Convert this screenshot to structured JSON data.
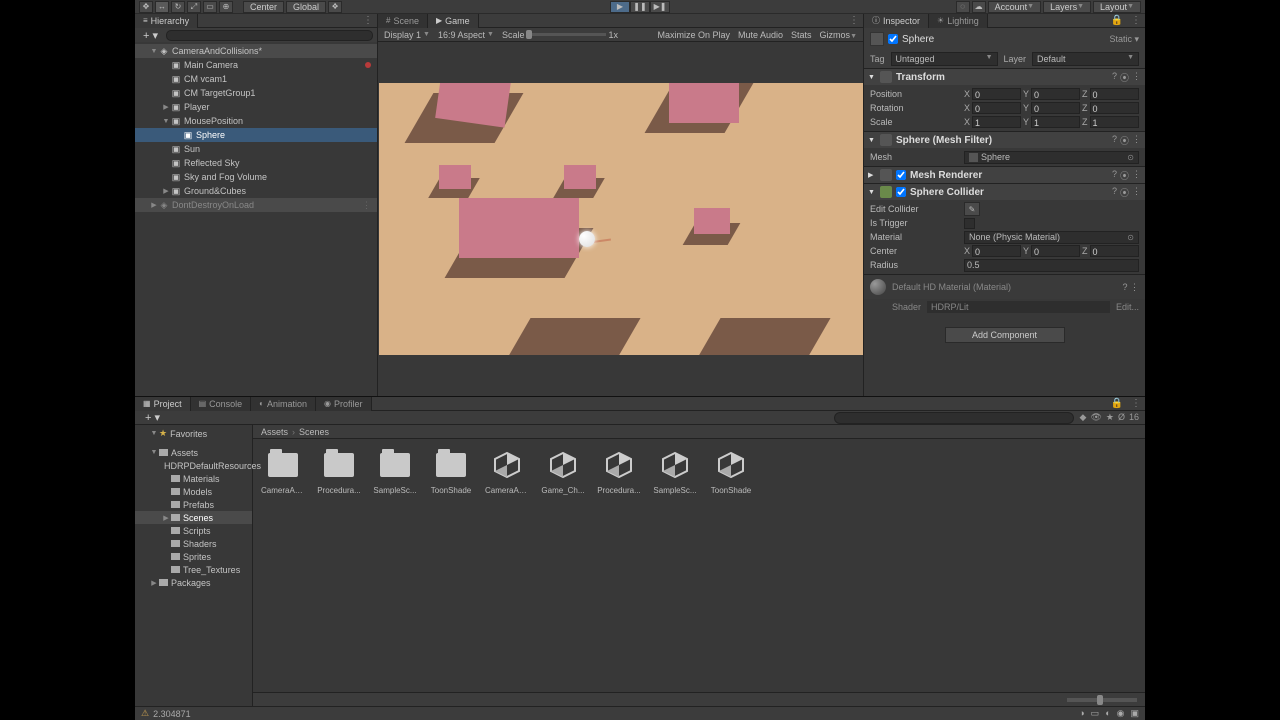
{
  "toolbar": {
    "handles": [
      "✥",
      "↔",
      "↻",
      "⤢",
      "▭",
      "⊕"
    ],
    "pivot": "Center",
    "space": "Global",
    "play_active": true,
    "account": "Account",
    "layers": "Layers",
    "layout": "Layout"
  },
  "hierarchy": {
    "tab": "Hierarchy",
    "scene": "CameraAndCollisions*",
    "items": [
      {
        "name": "Main Camera",
        "indent": 2,
        "rec": true
      },
      {
        "name": "CM vcam1",
        "indent": 2
      },
      {
        "name": "CM TargetGroup1",
        "indent": 2
      },
      {
        "name": "Player",
        "indent": 2,
        "fold": "▶"
      },
      {
        "name": "MousePosition",
        "indent": 2,
        "fold": "▼"
      },
      {
        "name": "Sphere",
        "indent": 3,
        "selected": true
      },
      {
        "name": "Sun",
        "indent": 2
      },
      {
        "name": "Reflected Sky",
        "indent": 2
      },
      {
        "name": "Sky and Fog Volume",
        "indent": 2
      },
      {
        "name": "Ground&Cubes",
        "indent": 2,
        "fold": "▶"
      },
      {
        "name": "DontDestroyOnLoad",
        "indent": 1,
        "grey": true,
        "scene": true
      }
    ]
  },
  "scene_tabs": {
    "scene": "Scene",
    "game": "Game",
    "active": "Game"
  },
  "game_bar": {
    "display": "Display 1",
    "aspect": "16:9 Aspect",
    "scale_lbl": "Scale",
    "scale_val": "1x",
    "maximize": "Maximize On Play",
    "mute": "Mute Audio",
    "stats": "Stats",
    "gizmos": "Gizmos"
  },
  "inspector": {
    "tabs": {
      "inspector": "Inspector",
      "lighting": "Lighting"
    },
    "obj_name": "Sphere",
    "static": "Static",
    "tag_lbl": "Tag",
    "tag_val": "Untagged",
    "layer_lbl": "Layer",
    "layer_val": "Default",
    "transform": {
      "title": "Transform",
      "pos_lbl": "Position",
      "px": "0",
      "py": "0",
      "pz": "0",
      "rot_lbl": "Rotation",
      "rx": "0",
      "ry": "0",
      "rz": "0",
      "scl_lbl": "Scale",
      "sx": "1",
      "sy": "1",
      "sz": "1"
    },
    "meshfilter": {
      "title": "Sphere (Mesh Filter)",
      "mesh_lbl": "Mesh",
      "mesh_val": "Sphere"
    },
    "meshrenderer": {
      "title": "Mesh Renderer"
    },
    "collider": {
      "title": "Sphere Collider",
      "edit_lbl": "Edit Collider",
      "trigger_lbl": "Is Trigger",
      "material_lbl": "Material",
      "material_val": "None (Physic Material)",
      "center_lbl": "Center",
      "cx": "0",
      "cy": "0",
      "cz": "0",
      "radius_lbl": "Radius",
      "radius_val": "0.5"
    },
    "material": {
      "name": "Default HD Material (Material)",
      "shader_lbl": "Shader",
      "shader_val": "HDRP/Lit",
      "edit": "Edit..."
    },
    "add_component": "Add Component"
  },
  "project": {
    "tabs": {
      "project": "Project",
      "console": "Console",
      "animation": "Animation",
      "profiler": "Profiler"
    },
    "breadcrumb": [
      "Assets",
      "Scenes"
    ],
    "favorites": "Favorites",
    "assets": "Assets",
    "packages": "Packages",
    "folders": [
      "HDRPDefaultResources",
      "Materials",
      "Models",
      "Prefabs",
      "Scenes",
      "Scripts",
      "Shaders",
      "Sprites",
      "Tree_Textures"
    ],
    "selected_folder": "Scenes",
    "grid": [
      {
        "name": "CameraAn...",
        "type": "folder"
      },
      {
        "name": "Procedura...",
        "type": "folder"
      },
      {
        "name": "SampleSc...",
        "type": "folder"
      },
      {
        "name": "ToonShade",
        "type": "folder"
      },
      {
        "name": "CameraAn...",
        "type": "scene"
      },
      {
        "name": "Game_Ch...",
        "type": "scene"
      },
      {
        "name": "Procedura...",
        "type": "scene"
      },
      {
        "name": "SampleSc...",
        "type": "scene"
      },
      {
        "name": "ToonShade",
        "type": "scene"
      }
    ],
    "slider_count": "16"
  },
  "status": {
    "msg": "2.304871"
  }
}
